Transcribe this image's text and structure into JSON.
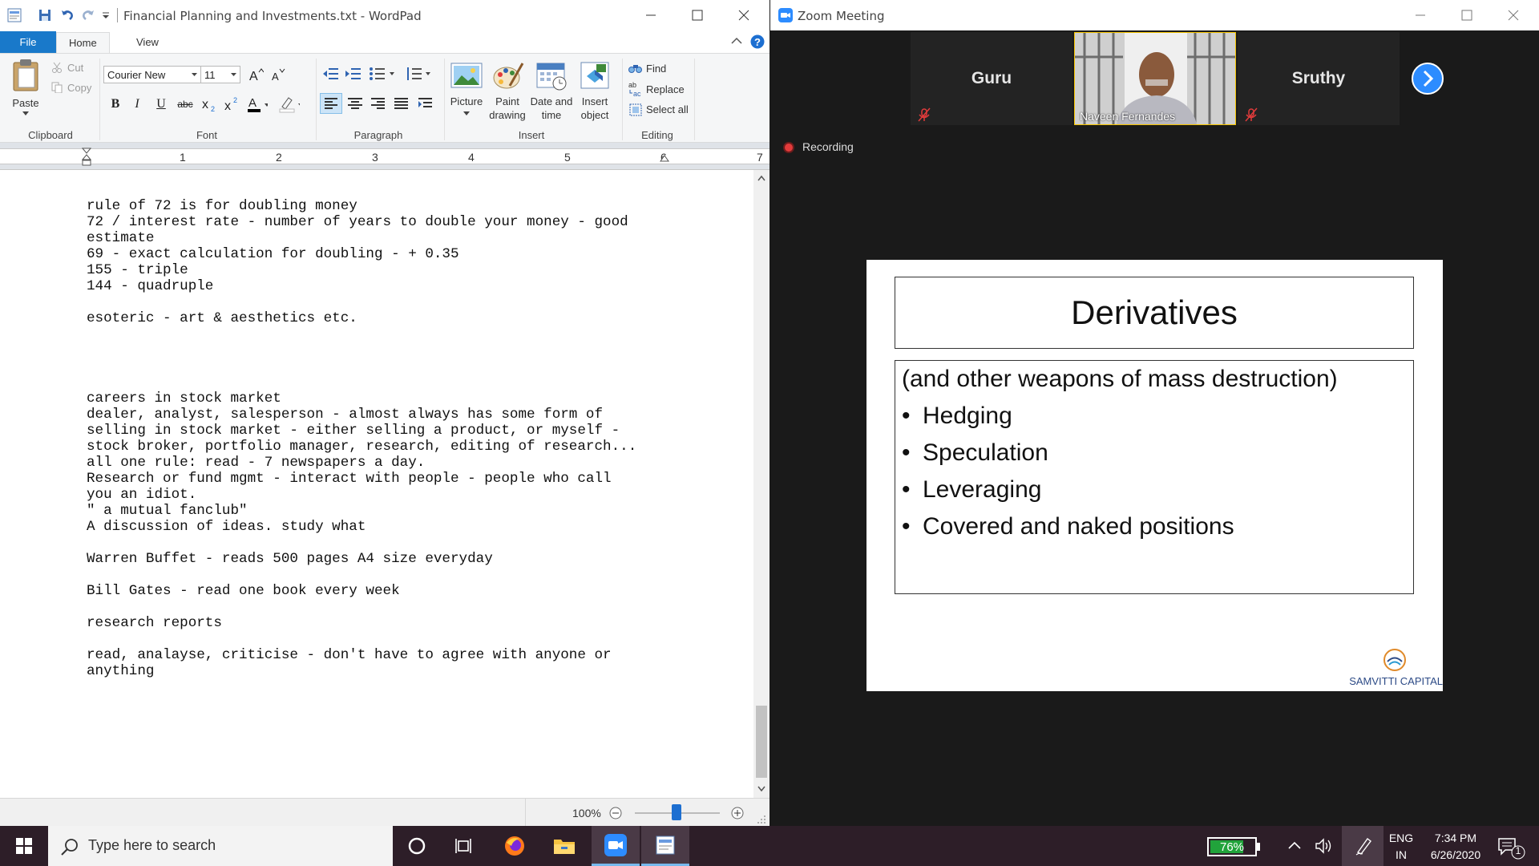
{
  "wordpad": {
    "title": "Financial Planning and Investments.txt - WordPad",
    "tabs": {
      "file": "File",
      "home": "Home",
      "view": "View"
    },
    "clipboard": {
      "paste": "Paste",
      "cut": "Cut",
      "copy": "Copy",
      "group": "Clipboard"
    },
    "font": {
      "name": "Courier New",
      "size": "11",
      "group": "Font"
    },
    "paragraph": {
      "group": "Paragraph"
    },
    "insert": {
      "picture": "Picture",
      "paint_1": "Paint",
      "paint_2": "drawing",
      "date_1": "Date and",
      "date_2": "time",
      "object_1": "Insert",
      "object_2": "object",
      "group": "Insert"
    },
    "editing": {
      "find": "Find",
      "replace": "Replace",
      "select_all": "Select all",
      "group": "Editing"
    },
    "ruler": [
      "1",
      "2",
      "3",
      "4",
      "5",
      "6",
      "7"
    ],
    "document_lines": [
      "rule of 72 is for doubling money",
      "72 / interest rate - number of years to double your money - good",
      "estimate",
      "69 - exact calculation for doubling - + 0.35",
      "155 - triple",
      "144 - quadruple",
      "",
      "esoteric - art & aesthetics etc.",
      "",
      "",
      "",
      "",
      "careers in stock market",
      "dealer, analyst, salesperson - almost always has some form of",
      "selling in stock market - either selling a product, or myself -",
      "stock broker, portfolio manager, research, editing of research...",
      "all one rule: read - 7 newspapers a day.",
      "Research or fund mgmt - interact with people - people who call",
      "you an idiot.",
      "\" a mutual fanclub\"",
      "A discussion of ideas. study what",
      "",
      "Warren Buffet - reads 500 pages A4 size everyday",
      "",
      "Bill Gates - read one book every week",
      "",
      "research reports",
      "",
      "read, analayse, criticise - don't have to agree with anyone or",
      "anything"
    ],
    "zoom_level": "100%"
  },
  "zoom": {
    "title": "Zoom Meeting",
    "participants": [
      {
        "name": "Guru",
        "muted": true
      },
      {
        "name": "Naveen Fernandes",
        "muted": false
      },
      {
        "name": "Sruthy",
        "muted": true
      }
    ],
    "recording_label": "Recording",
    "slide": {
      "title": "Derivatives",
      "subtitle": "(and other weapons of mass destruction)",
      "bullets": [
        "Hedging",
        "Speculation",
        "Leveraging",
        "Covered and naked positions"
      ],
      "logo_text": "SAMVITTI CAPITAL"
    }
  },
  "taskbar": {
    "search_placeholder": "Type here to search",
    "battery": "76%",
    "lang_1": "ENG",
    "lang_2": "IN",
    "time": "7:34 PM",
    "date": "6/26/2020",
    "notifications": "1"
  }
}
